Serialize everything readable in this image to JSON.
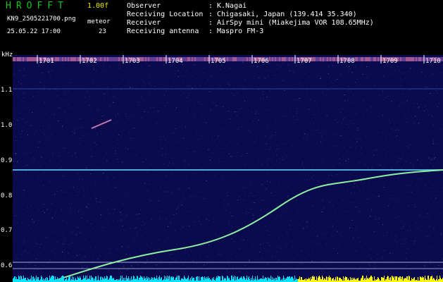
{
  "header": {
    "app_title": "HROFFT",
    "version": "1.00f",
    "file_name": "KN9_2505221700.png",
    "meteor_label": "meteor",
    "timestamp": "25.05.22 17:00",
    "meteor_count": "23"
  },
  "station_info": [
    {
      "label": "Observer",
      "value": "K.Nagai"
    },
    {
      "label": "Receiving Location",
      "value": "Chigasaki, Japan (139.414 35.340)"
    },
    {
      "label": "Receiver",
      "value": "AirSpy mini (Miakejima VOR 108.65MHz)"
    },
    {
      "label": "Receiving antenna",
      "value": "Maspro FM-3"
    }
  ],
  "plot": {
    "y_unit": "kHz",
    "y_ticks": [
      "1.1",
      "1.0",
      "0.9",
      "0.8",
      "0.7",
      "0.6"
    ],
    "time_markers": [
      "1701",
      "1702",
      "1703",
      "1704",
      "1705",
      "1706",
      "1707",
      "1708",
      "1709",
      "1710"
    ],
    "colors": {
      "background": "#0a0a4c",
      "noise": "#2a3fb0",
      "signal": "#8ff0a0",
      "carrier": "#5ec8f0",
      "bottom_noise": "#00e5ff",
      "bottom_noise_late": "#ffff00",
      "marker_text": "#ffffff"
    }
  }
}
